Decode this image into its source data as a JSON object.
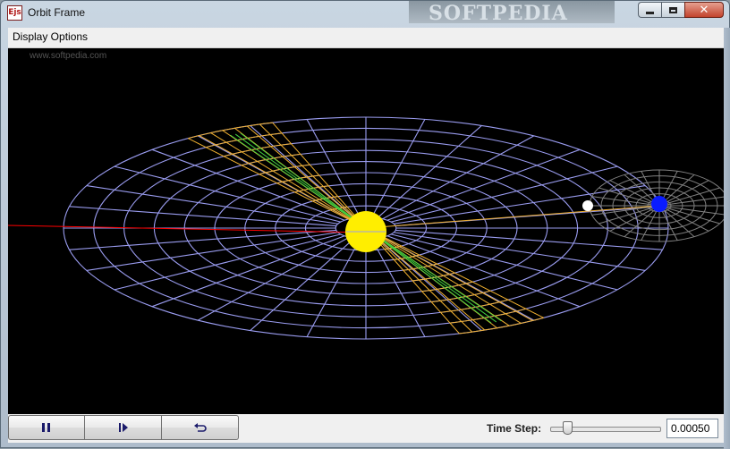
{
  "window": {
    "title": "Orbit Frame",
    "app_icon_text": "Ejs",
    "banner_text": "SOFTPEDIA"
  },
  "menu": {
    "display_options": "Display Options"
  },
  "scene": {
    "watermark": "www.softpedia.com",
    "colors": {
      "background": "#000000",
      "orbit_grid": "#9a9cf0",
      "sweep_sector": "#f0b030",
      "sweep_inner": "#40d040",
      "sun": "#ffee00",
      "planet": "#0a1cff",
      "moon": "#ffffff",
      "axis": "#ff0000",
      "moon_orbit": "#808080"
    }
  },
  "controls": {
    "pause_icon": "pause-icon",
    "step_icon": "step-forward-icon",
    "reset_icon": "reset-icon",
    "time_step_label": "Time Step:",
    "time_step_value": "0.00050",
    "slider_level_fraction": 0.12
  }
}
